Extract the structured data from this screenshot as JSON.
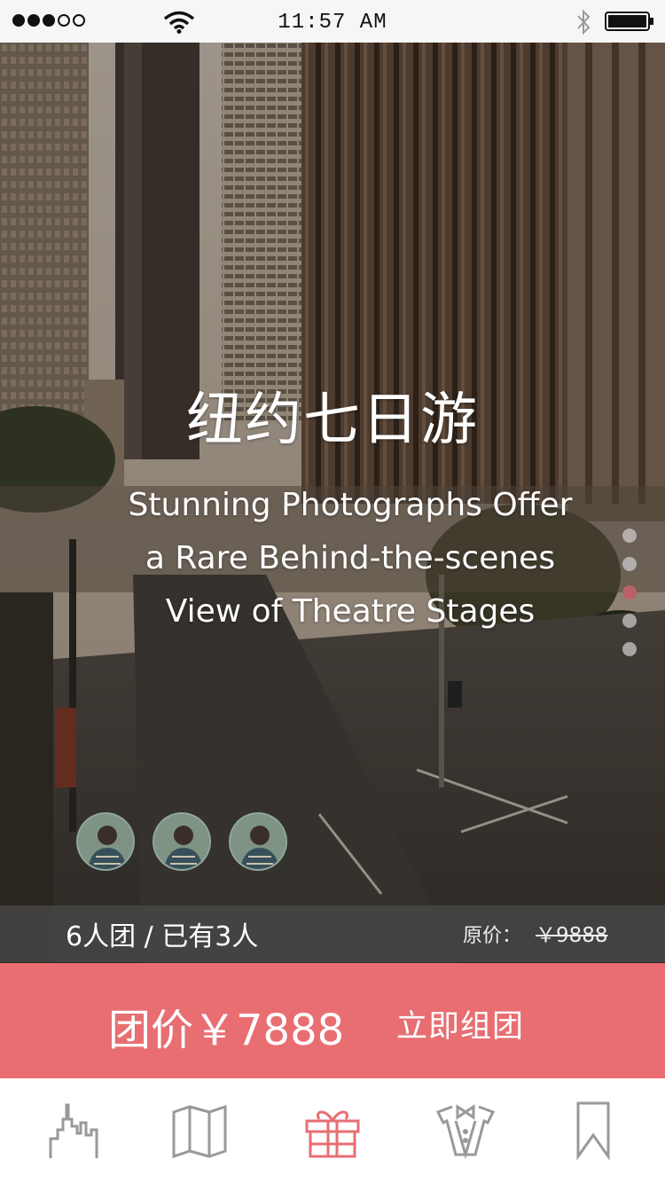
{
  "status_bar": {
    "time": "11:57 AM",
    "signal_dots_filled": 3,
    "signal_dots_total": 5
  },
  "hero": {
    "title": "纽约七日游",
    "subtitle_lines": [
      "Stunning Photographs Offer",
      "a Rare Behind-the-scenes",
      "View of Theatre Stages"
    ],
    "pager": {
      "count": 5,
      "active_index": 2,
      "active_color": "#b96167"
    },
    "member_avatars": 3
  },
  "group": {
    "info": "6人团 / 已有3人",
    "original_price_label": "原价：",
    "original_price": "￥9888"
  },
  "cta": {
    "price": "团价￥7888",
    "button_label": "立即组团",
    "color": "#e86e72"
  },
  "tabbar": {
    "items": [
      {
        "icon": "city-icon",
        "active": false
      },
      {
        "icon": "map-icon",
        "active": false
      },
      {
        "icon": "gift-icon",
        "active": true
      },
      {
        "icon": "tuxedo-icon",
        "active": false
      },
      {
        "icon": "bookmark-icon",
        "active": false
      }
    ],
    "active_color": "#e86e72",
    "inactive_color": "#999999"
  }
}
